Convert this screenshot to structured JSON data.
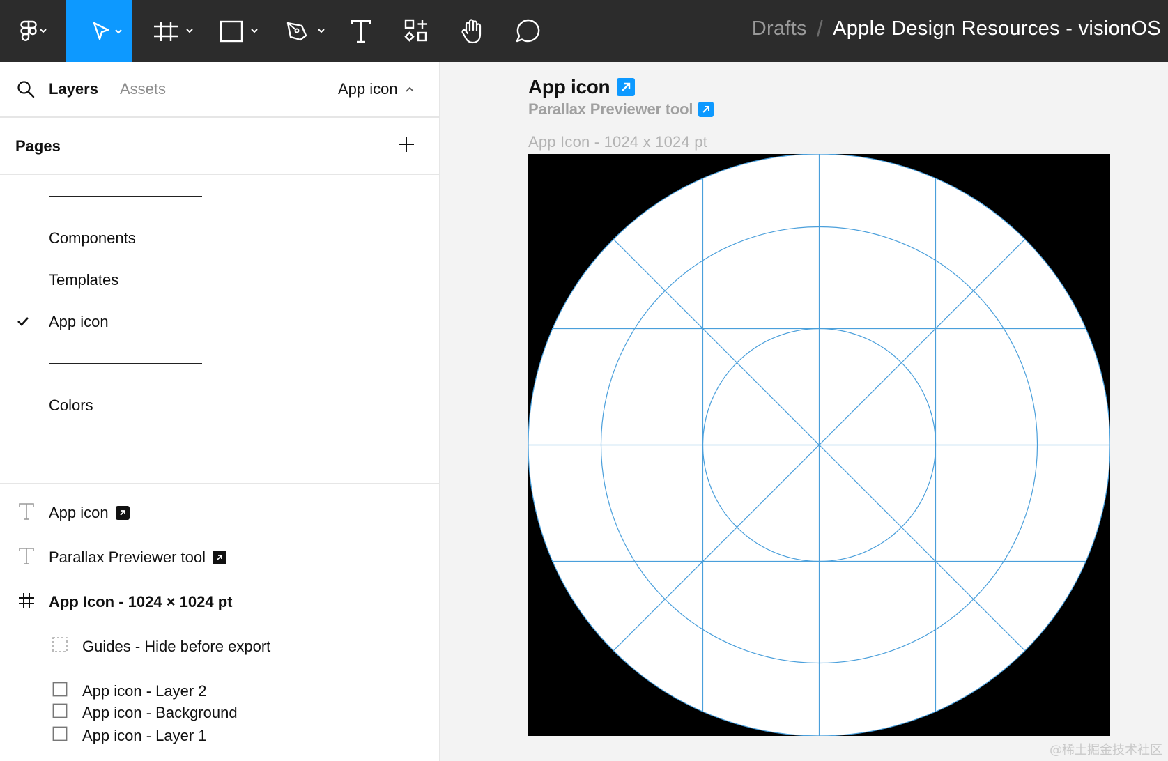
{
  "toolbar": {
    "tools": [
      {
        "name": "main-menu",
        "icon": "figma-logo-icon"
      },
      {
        "name": "move-tool",
        "icon": "cursor-icon",
        "active": true
      },
      {
        "name": "frame-tool",
        "icon": "frame-icon"
      },
      {
        "name": "shape-tool",
        "icon": "rectangle-icon"
      },
      {
        "name": "pen-tool",
        "icon": "pen-icon"
      },
      {
        "name": "text-tool",
        "icon": "text-icon"
      },
      {
        "name": "resources-tool",
        "icon": "components-icon"
      },
      {
        "name": "hand-tool",
        "icon": "hand-icon"
      },
      {
        "name": "comment-tool",
        "icon": "comment-icon"
      }
    ],
    "accent_color": "#0d99ff"
  },
  "breadcrumb": {
    "location": "Drafts",
    "separator": "/",
    "file_name": "Apple Design Resources - visionOS"
  },
  "left_panel": {
    "tabs": {
      "layers": "Layers",
      "assets": "Assets"
    },
    "current_page": "App icon",
    "pages_title": "Pages",
    "pages": [
      {
        "label": "",
        "type": "divider"
      },
      {
        "label": "Components"
      },
      {
        "label": "Templates"
      },
      {
        "label": "App icon",
        "selected": true
      },
      {
        "label": "",
        "type": "divider"
      },
      {
        "label": "Colors"
      }
    ],
    "layers": [
      {
        "label": "App icon",
        "icon": "text-layer-icon",
        "linked": true
      },
      {
        "label": "Parallax Previewer tool",
        "icon": "text-layer-icon",
        "linked": true
      },
      {
        "label": "App Icon - 1024 × 1024 pt",
        "icon": "frame-layer-icon"
      },
      {
        "label": "Guides - Hide before export",
        "icon": "hidden-group-icon"
      },
      {
        "label": "App icon - Layer 2",
        "icon": "rectangle-layer-icon"
      },
      {
        "label": "App icon - Layer 1",
        "icon": "rectangle-layer-icon"
      },
      {
        "label": "App icon - Background",
        "icon": "rectangle-layer-icon"
      }
    ]
  },
  "canvas": {
    "title": "App icon",
    "subtitle": "Parallax Previewer tool",
    "frame_label": "App Icon - 1024 x 1024 pt",
    "guide_color": "#4a9fdb",
    "frame_bg": "#000000",
    "circle_fill": "#ffffff"
  },
  "watermark": "@稀土掘金技术社区"
}
